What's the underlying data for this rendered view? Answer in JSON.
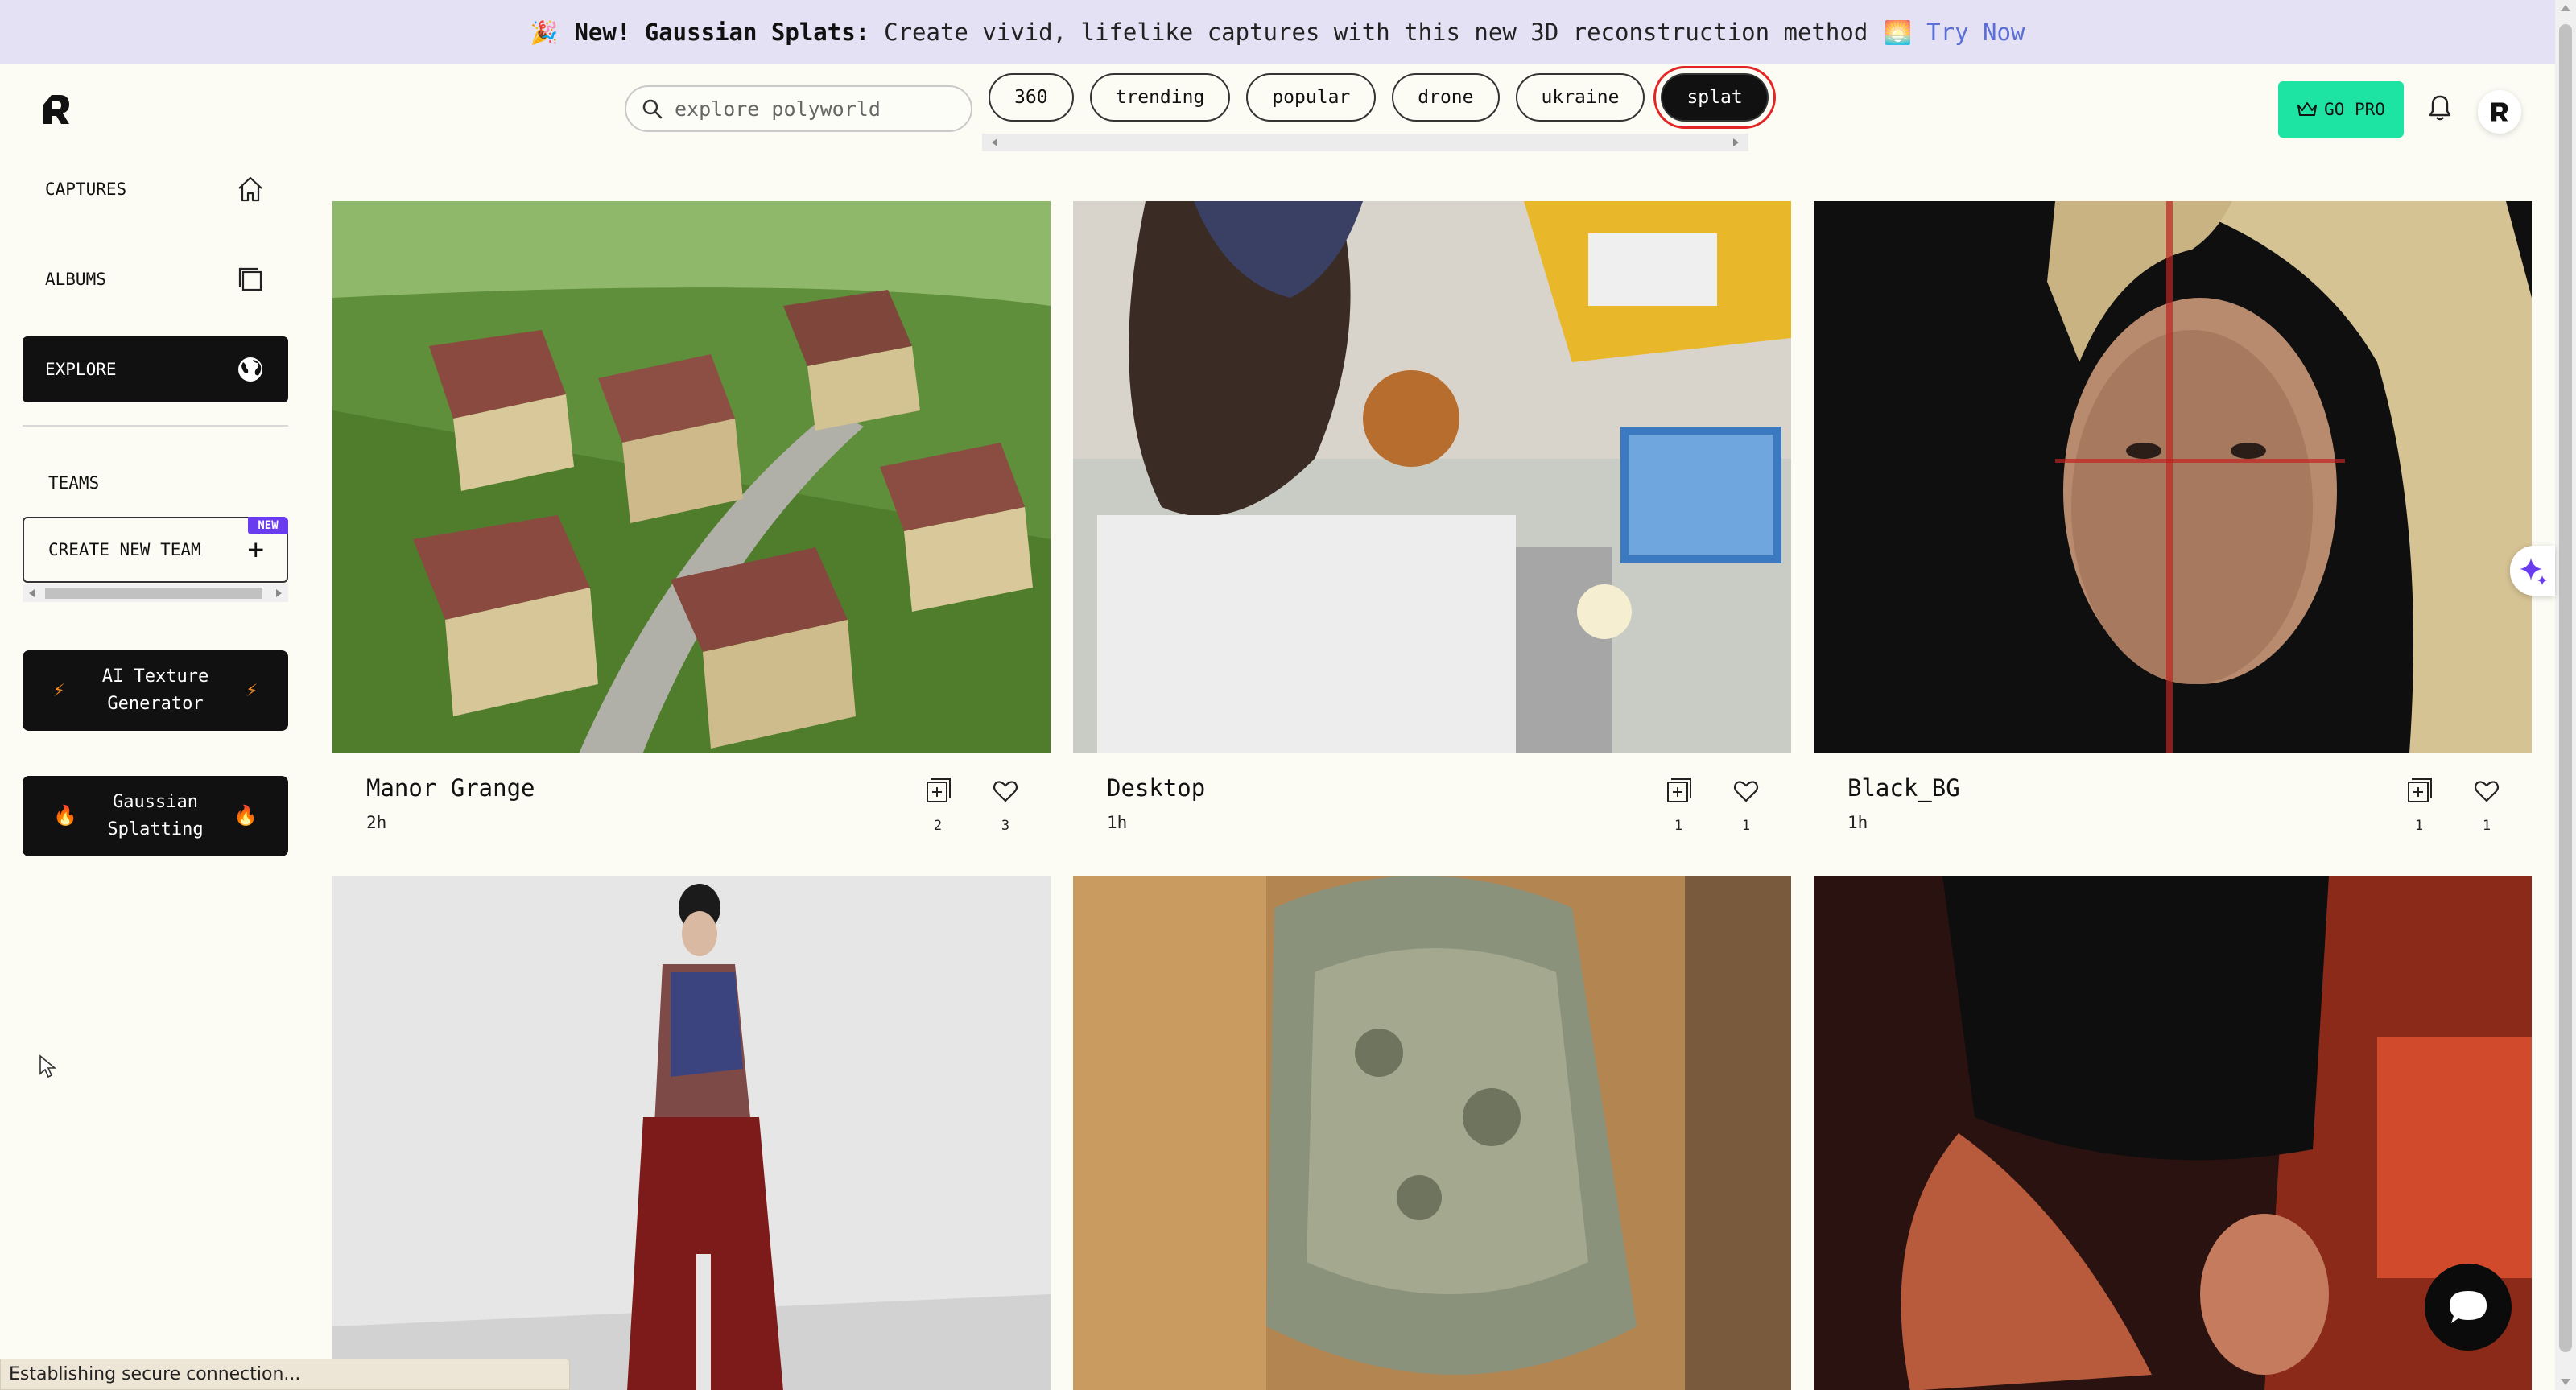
{
  "banner": {
    "prefix_emoji": "🎉",
    "headline": "New! Gaussian Splats:",
    "body": "Create vivid, lifelike captures with this new 3D reconstruction method",
    "suffix_emoji": "🌅",
    "cta": "Try Now",
    "cta_color": "#5b6fd6"
  },
  "search": {
    "placeholder": "explore polyworld"
  },
  "chips": [
    "360",
    "trending",
    "popular",
    "drone",
    "ukraine",
    "splat"
  ],
  "active_chip": "splat",
  "header": {
    "go_pro": "GO PRO"
  },
  "sidebar": {
    "nav": [
      {
        "label": "CAPTURES",
        "icon": "home-icon"
      },
      {
        "label": "ALBUMS",
        "icon": "albums-icon"
      },
      {
        "label": "EXPLORE",
        "icon": "globe-icon"
      }
    ],
    "teams_label": "TEAMS",
    "create_team": "CREATE NEW TEAM",
    "new_badge": "NEW",
    "features": [
      {
        "line1": "AI Texture",
        "line2": "Generator"
      },
      {
        "line1": "Gaussian",
        "line2": "Splatting"
      }
    ]
  },
  "cards": [
    {
      "title": "Manor Grange",
      "time": "2h",
      "adds": "2",
      "likes": "3"
    },
    {
      "title": "Desktop",
      "time": "1h",
      "adds": "1",
      "likes": "1"
    },
    {
      "title": "Black_BG",
      "time": "1h",
      "adds": "1",
      "likes": "1"
    },
    {
      "title": "",
      "time": "",
      "adds": "",
      "likes": ""
    },
    {
      "title": "",
      "time": "",
      "adds": "",
      "likes": ""
    },
    {
      "title": "",
      "time": "",
      "adds": "",
      "likes": ""
    }
  ],
  "status": {
    "text": "Establishing secure connection..."
  },
  "colors": {
    "accent": "#1de4a3",
    "badge": "#6a3cf0",
    "banner_bg": "#e4e1f4"
  }
}
